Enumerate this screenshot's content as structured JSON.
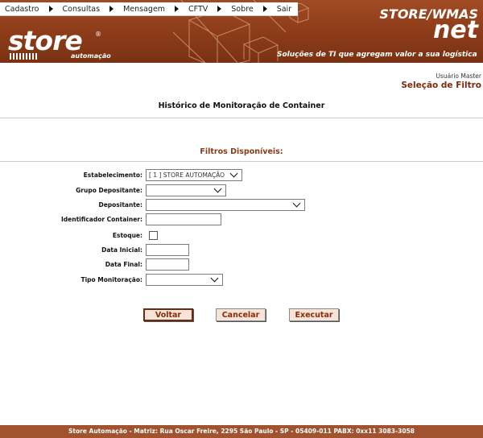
{
  "menu": {
    "items": [
      {
        "label": "Cadastro"
      },
      {
        "label": "Consultas"
      },
      {
        "label": "Mensagem"
      },
      {
        "label": "CFTV"
      },
      {
        "label": "Sobre"
      },
      {
        "label": "Sair"
      }
    ]
  },
  "header": {
    "logo_word": "store",
    "logo_registered": "®",
    "logo_sub": "automação",
    "brand_line1": "STORE/WMAS",
    "brand_line2": "net",
    "tagline": "Soluções de TI que agregam valor a sua logística"
  },
  "user": {
    "name": "Usuário Master",
    "section": "Seleção de Filtro"
  },
  "page": {
    "title": "Histórico de Monitoração de Container",
    "filters_title": "Filtros Disponíveis:"
  },
  "form": {
    "estabelecimento": {
      "label": "Estabelecimento:",
      "value": "[ 1 ] STORE AUTOMAÇÃO"
    },
    "grupo_depositante": {
      "label": "Grupo Depositante:",
      "value": ""
    },
    "depositante": {
      "label": "Depositante:",
      "value": ""
    },
    "identificador_container": {
      "label": "Identificador Container:",
      "value": ""
    },
    "estoque": {
      "label": "Estoque:",
      "checked": false
    },
    "data_inicial": {
      "label": "Data Inicial:",
      "value": ""
    },
    "data_final": {
      "label": "Data Final:",
      "value": ""
    },
    "tipo_monitoracao": {
      "label": "Tipo Monitoração:",
      "value": ""
    }
  },
  "buttons": {
    "voltar": "Voltar",
    "cancelar": "Cancelar",
    "executar": "Executar"
  },
  "footer": {
    "text": "Store Automação - Matriz: Rua Oscar Freire, 2295 São Paulo - SP - 05409-011 PABX: 0xx11 3083-3058"
  },
  "colors": {
    "header_brown": "#8c3b18",
    "accent_text": "#8a2a0a",
    "button_bg": "#f6e4d8",
    "footer_bg": "#a0532e"
  }
}
